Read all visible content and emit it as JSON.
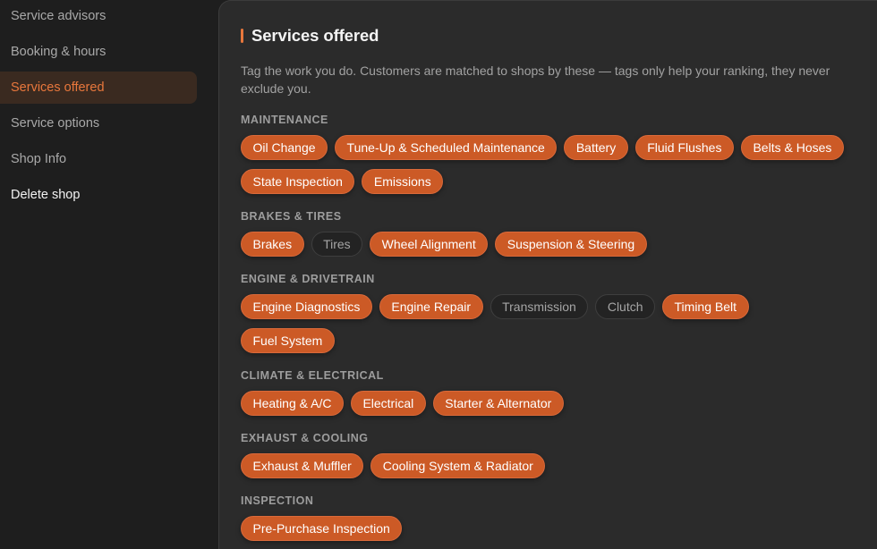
{
  "sidebar": {
    "items": [
      {
        "label": "Service advisors"
      },
      {
        "label": "Booking & hours"
      },
      {
        "label": "Services offered"
      },
      {
        "label": "Service options"
      },
      {
        "label": "Shop Info"
      },
      {
        "label": "Delete shop"
      }
    ],
    "active_index": 2
  },
  "panel": {
    "title": "Services offered",
    "description": "Tag the work you do. Customers are matched to shops by these — tags only help your ranking, they never exclude you.",
    "groups": [
      {
        "label": "MAINTENANCE",
        "chips": [
          {
            "label": "Oil Change",
            "selected": true
          },
          {
            "label": "Tune-Up & Scheduled Maintenance",
            "selected": true
          },
          {
            "label": "Battery",
            "selected": true
          },
          {
            "label": "Fluid Flushes",
            "selected": true
          },
          {
            "label": "Belts & Hoses",
            "selected": true
          },
          {
            "label": "State Inspection",
            "selected": true
          },
          {
            "label": "Emissions",
            "selected": true
          }
        ]
      },
      {
        "label": "BRAKES & TIRES",
        "chips": [
          {
            "label": "Brakes",
            "selected": true
          },
          {
            "label": "Tires",
            "selected": false
          },
          {
            "label": "Wheel Alignment",
            "selected": true
          },
          {
            "label": "Suspension & Steering",
            "selected": true
          }
        ]
      },
      {
        "label": "ENGINE & DRIVETRAIN",
        "chips": [
          {
            "label": "Engine Diagnostics",
            "selected": true
          },
          {
            "label": "Engine Repair",
            "selected": true
          },
          {
            "label": "Transmission",
            "selected": false
          },
          {
            "label": "Clutch",
            "selected": false
          },
          {
            "label": "Timing Belt",
            "selected": true
          },
          {
            "label": "Fuel System",
            "selected": true
          }
        ]
      },
      {
        "label": "CLIMATE & ELECTRICAL",
        "chips": [
          {
            "label": "Heating & A/C",
            "selected": true
          },
          {
            "label": "Electrical",
            "selected": true
          },
          {
            "label": "Starter & Alternator",
            "selected": true
          }
        ]
      },
      {
        "label": "EXHAUST & COOLING",
        "chips": [
          {
            "label": "Exhaust & Muffler",
            "selected": true
          },
          {
            "label": "Cooling System & Radiator",
            "selected": true
          }
        ]
      },
      {
        "label": "INSPECTION",
        "chips": [
          {
            "label": "Pre-Purchase Inspection",
            "selected": true
          }
        ]
      }
    ]
  },
  "colors": {
    "accent": "#e8773c",
    "chip_selected_bg": "#cc5a26",
    "chip_unselected_bg": "#232323",
    "panel_bg": "#2b2b2b",
    "page_bg": "#1e1e1e"
  }
}
